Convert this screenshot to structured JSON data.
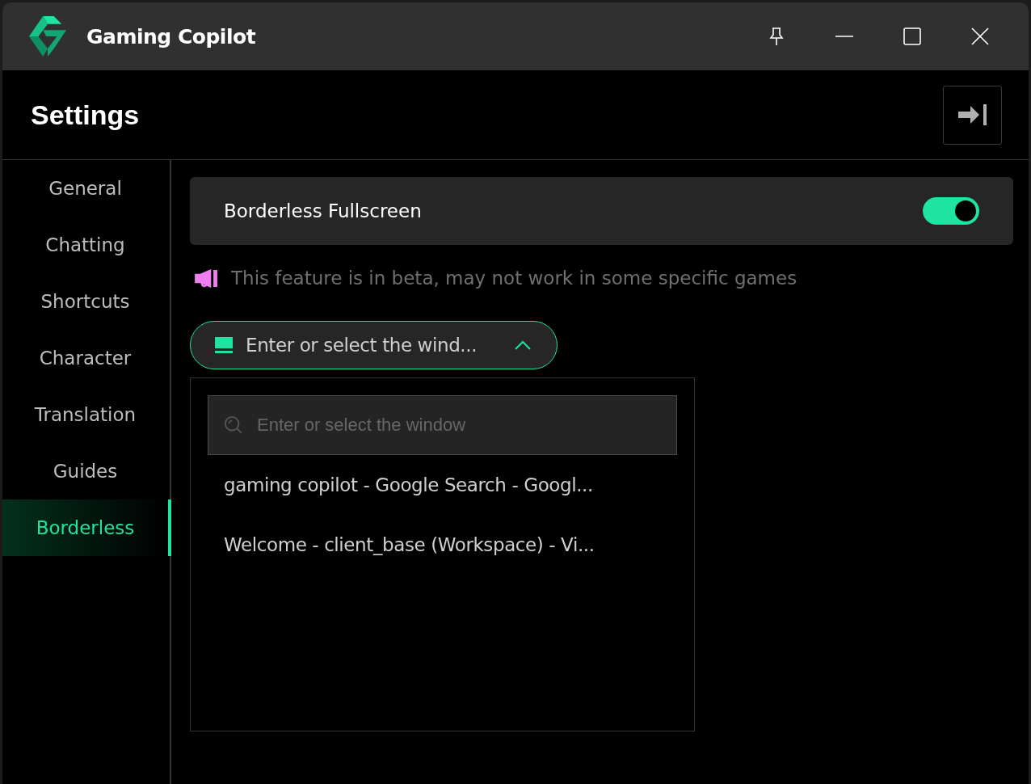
{
  "window": {
    "title": "Gaming Copilot"
  },
  "header": {
    "title": "Settings"
  },
  "sidebar": {
    "items": [
      {
        "label": "General",
        "selected": false
      },
      {
        "label": "Chatting",
        "selected": false
      },
      {
        "label": "Shortcuts",
        "selected": false
      },
      {
        "label": "Character",
        "selected": false
      },
      {
        "label": "Translation",
        "selected": false
      },
      {
        "label": "Guides",
        "selected": false
      },
      {
        "label": "Borderless",
        "selected": true
      }
    ]
  },
  "setting": {
    "label": "Borderless Fullscreen",
    "on": true
  },
  "notice": "This feature is in beta, may not work in some specific games",
  "window_select": {
    "value": "Enter or select the wind...",
    "expanded": true,
    "search": {
      "placeholder": "Enter or select the window"
    },
    "options": [
      "gaming copilot - Google Search - Googl...",
      "Welcome - client_base (Workspace) - Vi..."
    ]
  }
}
